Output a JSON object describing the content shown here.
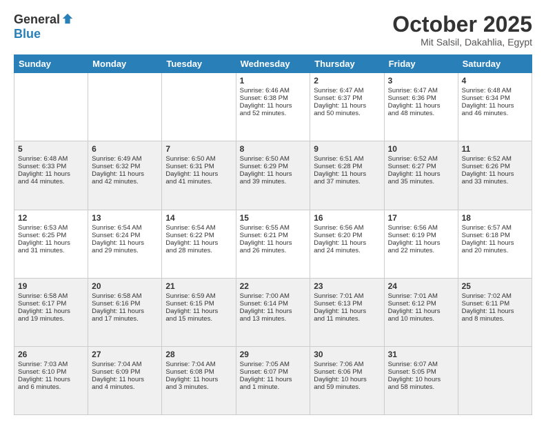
{
  "logo": {
    "general": "General",
    "blue": "Blue"
  },
  "title": "October 2025",
  "location": "Mit Salsil, Dakahlia, Egypt",
  "headers": [
    "Sunday",
    "Monday",
    "Tuesday",
    "Wednesday",
    "Thursday",
    "Friday",
    "Saturday"
  ],
  "weeks": [
    [
      {
        "day": "",
        "lines": []
      },
      {
        "day": "",
        "lines": []
      },
      {
        "day": "",
        "lines": []
      },
      {
        "day": "1",
        "lines": [
          "Sunrise: 6:46 AM",
          "Sunset: 6:38 PM",
          "Daylight: 11 hours",
          "and 52 minutes."
        ]
      },
      {
        "day": "2",
        "lines": [
          "Sunrise: 6:47 AM",
          "Sunset: 6:37 PM",
          "Daylight: 11 hours",
          "and 50 minutes."
        ]
      },
      {
        "day": "3",
        "lines": [
          "Sunrise: 6:47 AM",
          "Sunset: 6:36 PM",
          "Daylight: 11 hours",
          "and 48 minutes."
        ]
      },
      {
        "day": "4",
        "lines": [
          "Sunrise: 6:48 AM",
          "Sunset: 6:34 PM",
          "Daylight: 11 hours",
          "and 46 minutes."
        ]
      }
    ],
    [
      {
        "day": "5",
        "lines": [
          "Sunrise: 6:48 AM",
          "Sunset: 6:33 PM",
          "Daylight: 11 hours",
          "and 44 minutes."
        ]
      },
      {
        "day": "6",
        "lines": [
          "Sunrise: 6:49 AM",
          "Sunset: 6:32 PM",
          "Daylight: 11 hours",
          "and 42 minutes."
        ]
      },
      {
        "day": "7",
        "lines": [
          "Sunrise: 6:50 AM",
          "Sunset: 6:31 PM",
          "Daylight: 11 hours",
          "and 41 minutes."
        ]
      },
      {
        "day": "8",
        "lines": [
          "Sunrise: 6:50 AM",
          "Sunset: 6:29 PM",
          "Daylight: 11 hours",
          "and 39 minutes."
        ]
      },
      {
        "day": "9",
        "lines": [
          "Sunrise: 6:51 AM",
          "Sunset: 6:28 PM",
          "Daylight: 11 hours",
          "and 37 minutes."
        ]
      },
      {
        "day": "10",
        "lines": [
          "Sunrise: 6:52 AM",
          "Sunset: 6:27 PM",
          "Daylight: 11 hours",
          "and 35 minutes."
        ]
      },
      {
        "day": "11",
        "lines": [
          "Sunrise: 6:52 AM",
          "Sunset: 6:26 PM",
          "Daylight: 11 hours",
          "and 33 minutes."
        ]
      }
    ],
    [
      {
        "day": "12",
        "lines": [
          "Sunrise: 6:53 AM",
          "Sunset: 6:25 PM",
          "Daylight: 11 hours",
          "and 31 minutes."
        ]
      },
      {
        "day": "13",
        "lines": [
          "Sunrise: 6:54 AM",
          "Sunset: 6:24 PM",
          "Daylight: 11 hours",
          "and 29 minutes."
        ]
      },
      {
        "day": "14",
        "lines": [
          "Sunrise: 6:54 AM",
          "Sunset: 6:22 PM",
          "Daylight: 11 hours",
          "and 28 minutes."
        ]
      },
      {
        "day": "15",
        "lines": [
          "Sunrise: 6:55 AM",
          "Sunset: 6:21 PM",
          "Daylight: 11 hours",
          "and 26 minutes."
        ]
      },
      {
        "day": "16",
        "lines": [
          "Sunrise: 6:56 AM",
          "Sunset: 6:20 PM",
          "Daylight: 11 hours",
          "and 24 minutes."
        ]
      },
      {
        "day": "17",
        "lines": [
          "Sunrise: 6:56 AM",
          "Sunset: 6:19 PM",
          "Daylight: 11 hours",
          "and 22 minutes."
        ]
      },
      {
        "day": "18",
        "lines": [
          "Sunrise: 6:57 AM",
          "Sunset: 6:18 PM",
          "Daylight: 11 hours",
          "and 20 minutes."
        ]
      }
    ],
    [
      {
        "day": "19",
        "lines": [
          "Sunrise: 6:58 AM",
          "Sunset: 6:17 PM",
          "Daylight: 11 hours",
          "and 19 minutes."
        ]
      },
      {
        "day": "20",
        "lines": [
          "Sunrise: 6:58 AM",
          "Sunset: 6:16 PM",
          "Daylight: 11 hours",
          "and 17 minutes."
        ]
      },
      {
        "day": "21",
        "lines": [
          "Sunrise: 6:59 AM",
          "Sunset: 6:15 PM",
          "Daylight: 11 hours",
          "and 15 minutes."
        ]
      },
      {
        "day": "22",
        "lines": [
          "Sunrise: 7:00 AM",
          "Sunset: 6:14 PM",
          "Daylight: 11 hours",
          "and 13 minutes."
        ]
      },
      {
        "day": "23",
        "lines": [
          "Sunrise: 7:01 AM",
          "Sunset: 6:13 PM",
          "Daylight: 11 hours",
          "and 11 minutes."
        ]
      },
      {
        "day": "24",
        "lines": [
          "Sunrise: 7:01 AM",
          "Sunset: 6:12 PM",
          "Daylight: 11 hours",
          "and 10 minutes."
        ]
      },
      {
        "day": "25",
        "lines": [
          "Sunrise: 7:02 AM",
          "Sunset: 6:11 PM",
          "Daylight: 11 hours",
          "and 8 minutes."
        ]
      }
    ],
    [
      {
        "day": "26",
        "lines": [
          "Sunrise: 7:03 AM",
          "Sunset: 6:10 PM",
          "Daylight: 11 hours",
          "and 6 minutes."
        ]
      },
      {
        "day": "27",
        "lines": [
          "Sunrise: 7:04 AM",
          "Sunset: 6:09 PM",
          "Daylight: 11 hours",
          "and 4 minutes."
        ]
      },
      {
        "day": "28",
        "lines": [
          "Sunrise: 7:04 AM",
          "Sunset: 6:08 PM",
          "Daylight: 11 hours",
          "and 3 minutes."
        ]
      },
      {
        "day": "29",
        "lines": [
          "Sunrise: 7:05 AM",
          "Sunset: 6:07 PM",
          "Daylight: 11 hours",
          "and 1 minute."
        ]
      },
      {
        "day": "30",
        "lines": [
          "Sunrise: 7:06 AM",
          "Sunset: 6:06 PM",
          "Daylight: 10 hours",
          "and 59 minutes."
        ]
      },
      {
        "day": "31",
        "lines": [
          "Sunrise: 6:07 AM",
          "Sunset: 5:05 PM",
          "Daylight: 10 hours",
          "and 58 minutes."
        ]
      },
      {
        "day": "",
        "lines": []
      }
    ]
  ]
}
